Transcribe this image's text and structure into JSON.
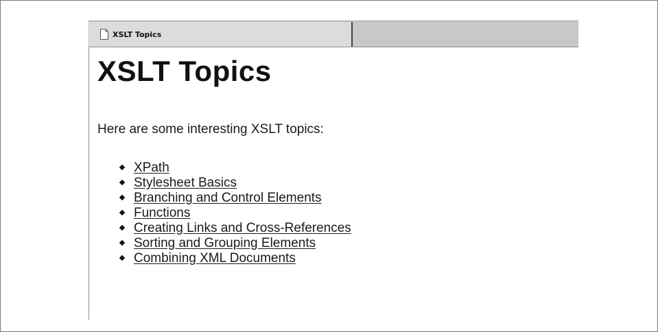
{
  "tab": {
    "title": "XSLT Topics",
    "icon": "document-icon"
  },
  "page": {
    "heading": "XSLT Topics",
    "intro": "Here are some interesting XSLT topics:"
  },
  "topics": [
    {
      "label": "XPath"
    },
    {
      "label": "Stylesheet Basics"
    },
    {
      "label": "Branching and Control Elements"
    },
    {
      "label": "Functions"
    },
    {
      "label": "Creating Links and Cross-References"
    },
    {
      "label": "Sorting and Grouping Elements"
    },
    {
      "label": "Combining XML Documents"
    }
  ]
}
